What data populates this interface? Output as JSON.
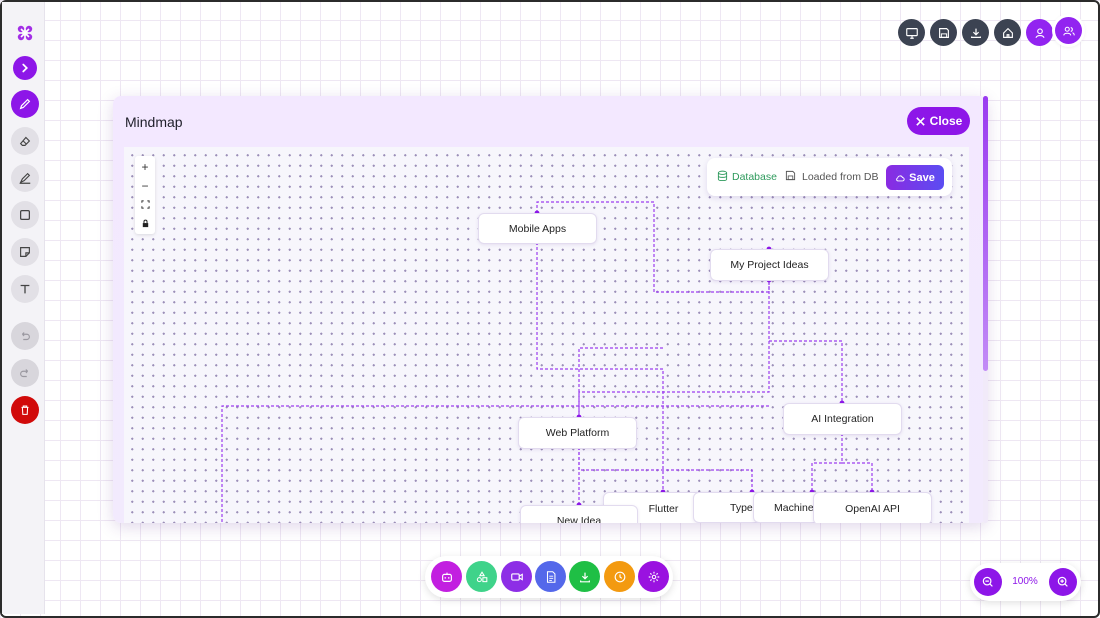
{
  "modal": {
    "title": "Mindmap",
    "close_label": "Close"
  },
  "db_panel": {
    "source_label": "Database",
    "status_label": "Loaded from DB",
    "save_label": "Save"
  },
  "canvas_controls": {
    "zoom_in": "+",
    "zoom_out": "−"
  },
  "nodes": {
    "mobile_apps": "Mobile Apps",
    "my_project_ideas": "My Project Ideas",
    "ai_integration": "AI Integration",
    "web_platform": "Web Platform",
    "new_idea": "New Idea",
    "flutter": "Flutter",
    "typescript": "TypeS",
    "machine": "Machine",
    "openai_api": "OpenAI API"
  },
  "zoom": {
    "level": "100%"
  },
  "left_toolbar": {
    "tools": [
      "logo-icon",
      "expand-icon",
      "pen-icon",
      "eraser-icon",
      "highlighter-icon",
      "rectangle-icon",
      "note-icon",
      "text-icon",
      "undo-icon",
      "redo-icon",
      "delete-icon"
    ],
    "active": "pen-icon"
  },
  "top_toolbar": [
    "present-icon",
    "save-icon",
    "download-icon",
    "home-icon",
    "user-icon",
    "users-icon"
  ],
  "bottom_toolbar": [
    {
      "icon": "robot-icon",
      "color": "#c21fe0"
    },
    {
      "icon": "shapes-icon",
      "color": "#3fd38a"
    },
    {
      "icon": "video-icon",
      "color": "#8d2ee6"
    },
    {
      "icon": "document-icon",
      "color": "#5468ea"
    },
    {
      "icon": "download-icon",
      "color": "#1fbf45"
    },
    {
      "icon": "clock-icon",
      "color": "#f39a10"
    },
    {
      "icon": "settings-icon",
      "color": "#9a12e0"
    }
  ],
  "colors": {
    "accent": "#8d16e8",
    "edge": "#9b3df0",
    "danger": "#d10a0a"
  }
}
